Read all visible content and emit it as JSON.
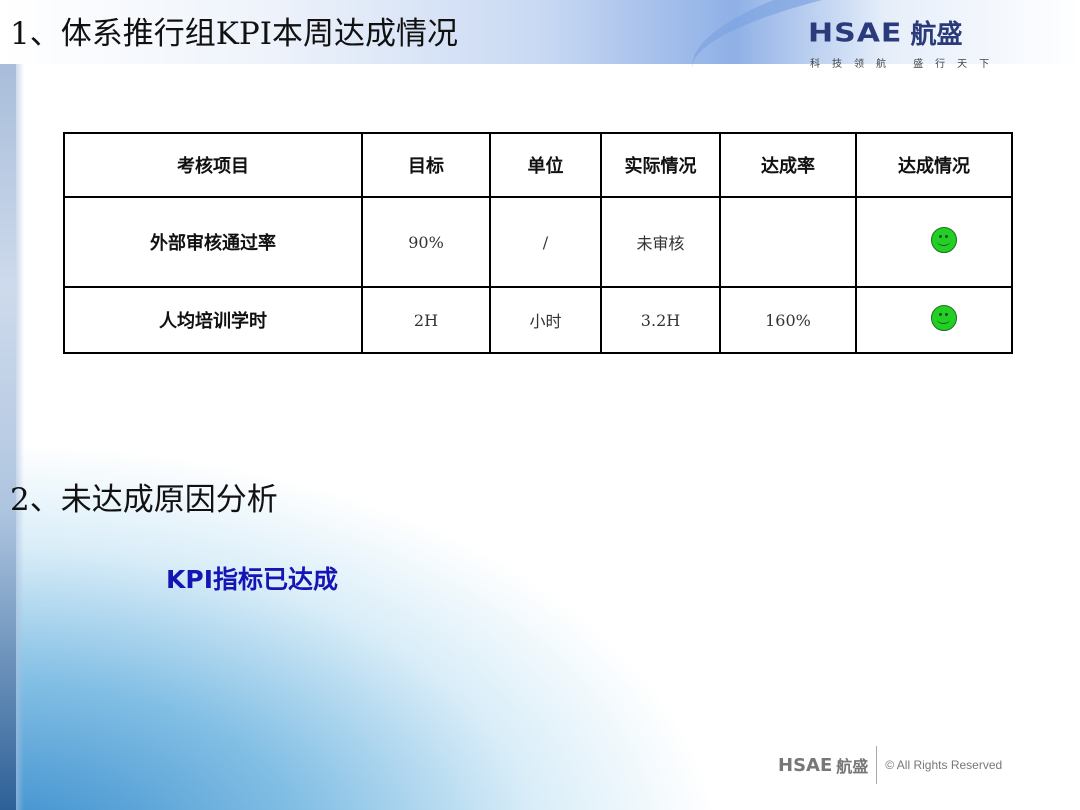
{
  "header": {
    "title": "1、体系推行组KPI本周达成情况",
    "logo": {
      "brand": "HSAE",
      "brand_cn": "航盛",
      "slogan": "科技领航 盛行天下"
    }
  },
  "table": {
    "columns": [
      "考核项目",
      "目标",
      "单位",
      "实际情况",
      "达成率",
      "达成情况"
    ],
    "rows": [
      {
        "item": "外部审核通过率",
        "target": "90%",
        "unit": "/",
        "actual": "未审核",
        "rate": "",
        "status_icon": "smiley-green"
      },
      {
        "item": "人均培训学时",
        "target": "2H",
        "unit": "小时",
        "actual": "3.2H",
        "rate": "160%",
        "status_icon": "smiley-green"
      }
    ]
  },
  "section2": {
    "title": "2、未达成原因分析",
    "conclusion": "KPI指标已达成"
  },
  "footer": {
    "brand": "HSAE",
    "brand_cn": "航盛",
    "rights": "© All Rights Reserved"
  },
  "colors": {
    "conclusion": "#1515b5",
    "status_ok": "#22d024",
    "logo": "#2a3a7a"
  }
}
